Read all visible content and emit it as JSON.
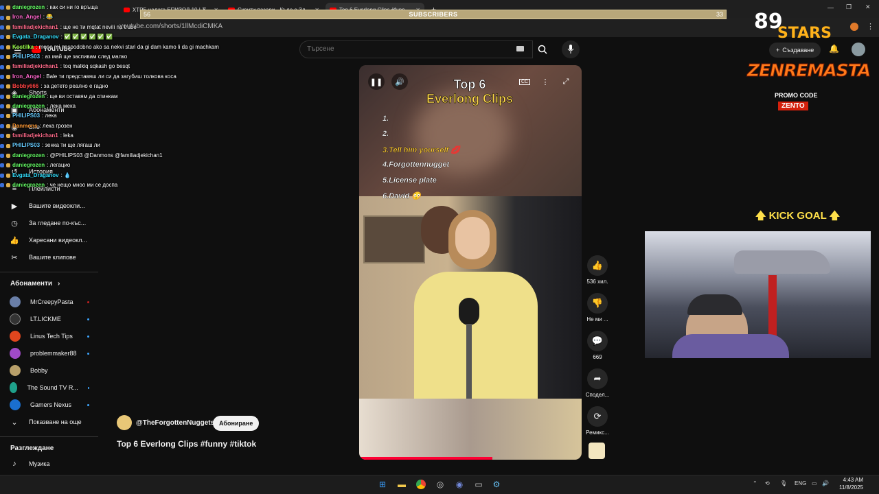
{
  "browser": {
    "tabs": [
      {
        "label": "ХТРБ налага ЕПИЗОД 10 | Ѫ..."
      },
      {
        "label": "Скрити пазари - Къде е Зл..."
      },
      {
        "label": "Top 6 Everlong Clips #funn..."
      }
    ],
    "url": "youtube.com/shorts/1llMcdiCMKA"
  },
  "subscribers_bar": {
    "label": "SUBSCRIBERS",
    "left": "56",
    "right": "33"
  },
  "chat": [
    {
      "user": "daniegrozen",
      "text": ": как си ни го връща",
      "color": "#66ff66"
    },
    {
      "user": "Iron_Angel",
      "text": ": 😂",
      "color": "#ff66cc"
    },
    {
      "user": "familiadjekichan1",
      "text": ": ще не ти mqtat nevili na trube",
      "color": "#ff6b8a"
    },
    {
      "user": "Evgata_Draganov",
      "text": ": ✅ ✅ ✅ ✅ ✅ ✅",
      "color": "#33e0ff"
    },
    {
      "user": "Kostilka",
      "text": ": mene mi nespodobno ako sa nekvi stari da gi dam kamo li da gi machkam",
      "color": "#9aff4a"
    },
    {
      "user": "PHILIPS03",
      "text": ": аз май ще заспивам след малко",
      "color": "#66ccff"
    },
    {
      "user": "familiadjekichan1",
      "text": ": toq malkiq sqkash go besqt",
      "color": "#ff6b8a"
    },
    {
      "user": "Iron_Angel",
      "text": ": Bale ти представяш ли си да загубиш толкова коса",
      "color": "#ff66cc"
    },
    {
      "user": "Bobby666",
      "text": ": за детето реално е гадно",
      "color": "#ff4444"
    },
    {
      "user": "daniegrozen",
      "text": ": ще ви оставям да спинкам",
      "color": "#66ff66"
    },
    {
      "user": "daniegrozen",
      "text": ": лека мека",
      "color": "#66ff66"
    },
    {
      "user": "PHILIPS03",
      "text": ": лека",
      "color": "#66ccff"
    },
    {
      "user": "Danmons",
      "text": ": лека грозен",
      "color": "#ff9933"
    },
    {
      "user": "familiadjekichan1",
      "text": ": leka",
      "color": "#ff6b8a"
    },
    {
      "user": "PHILIPS03",
      "text": ": зенка ти ще лягаш ли",
      "color": "#66ccff"
    },
    {
      "user": "daniegrozen",
      "text": ": @PHILIPS03 @Danmons @familiadjekichan1",
      "color": "#66ff66"
    },
    {
      "user": "daniegrozen",
      "text": ": легацио",
      "color": "#66ff66"
    },
    {
      "user": "Evgata_Draganov",
      "text": ": 💧",
      "color": "#33e0ff"
    },
    {
      "user": "daniegrozen",
      "text": ": че нещо мноо ми се доспа",
      "color": "#66ff66"
    }
  ],
  "header": {
    "logo": "YouTube",
    "search_placeholder": "Търсене",
    "create_label": "Създаване"
  },
  "sidebar": {
    "nav": [
      {
        "label": "Shorts"
      },
      {
        "label": "Абонаменти"
      },
      {
        "label": "Вие"
      },
      {
        "label": "История"
      },
      {
        "label": "Плейлисти"
      },
      {
        "label": "Вашите видеокли..."
      },
      {
        "label": "За гледане по-къс..."
      },
      {
        "label": "Харесани видеокл..."
      },
      {
        "label": "Вашите клипове"
      }
    ],
    "subs_heading": "Абонаменти",
    "subs": [
      {
        "label": "MrCreepyPasta",
        "color": "#6a7fa8"
      },
      {
        "label": "LT.LICKME",
        "color": "#333"
      },
      {
        "label": "Linus Tech Tips",
        "color": "#e0461e"
      },
      {
        "label": "problemmaker88",
        "color": "#a04ac8"
      },
      {
        "label": "Bobby",
        "color": "#b9a06a"
      },
      {
        "label": "The Sound TV R...",
        "color": "#1fa08a"
      },
      {
        "label": "Gamers Nexus",
        "color": "#1a6fcf"
      }
    ],
    "show_more": "Показване на още",
    "browse_heading": "Разглеждане",
    "browse": [
      {
        "label": "Музика"
      }
    ]
  },
  "video": {
    "title_line1": "Top 6",
    "title_line2": "Everlong Clips",
    "list": [
      "1.",
      "2.",
      "3.Tell him yourself 💋",
      "4.Forgottennugget",
      "5.License plate",
      "6.David 😳"
    ],
    "progress": 0.6
  },
  "actions": [
    {
      "label": "536 хил."
    },
    {
      "label": "Не ми ..."
    },
    {
      "label": "669"
    },
    {
      "label": "Сподел..."
    },
    {
      "label": "Ремикс..."
    }
  ],
  "channel": {
    "handle": "@TheForgottenNuggets",
    "subscribe_label": "Абониране"
  },
  "short_title": "Top 6 Everlong Clips #funny #tiktok",
  "overlays": {
    "logo_number": "89",
    "logo_word": "STARS",
    "sponsor": "ZENREMASTA",
    "promo": "PROMO CODE",
    "code": "ZENTO",
    "kick_goal": "🡅 KICK GOAL 🡅"
  },
  "taskbar": {
    "lang": "ENG",
    "time": "4:43 AM",
    "date": "11/8/2025"
  }
}
